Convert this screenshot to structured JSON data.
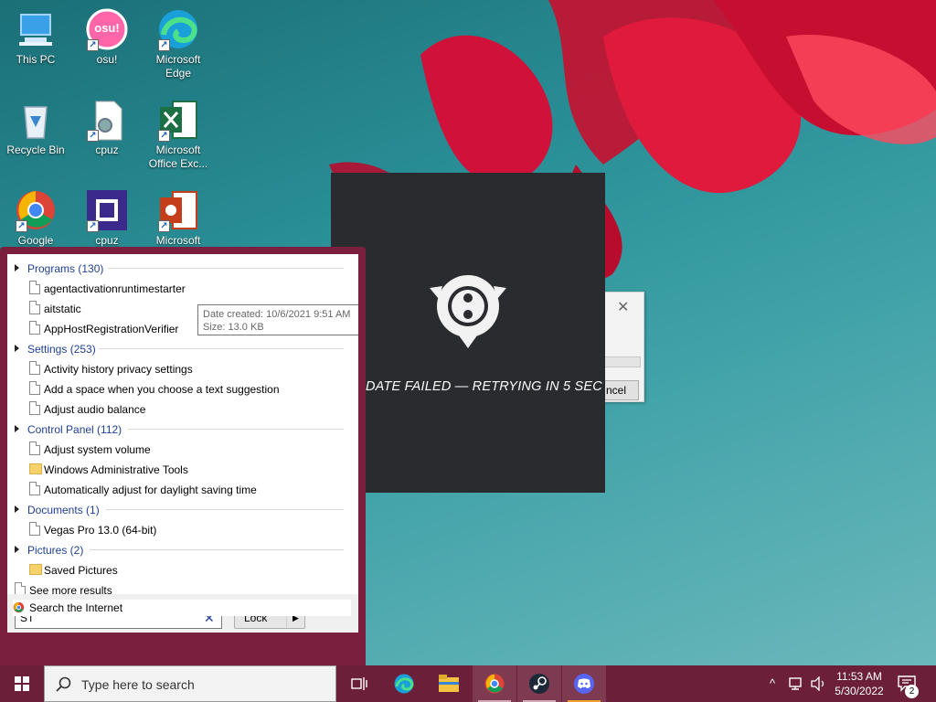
{
  "desktop": {
    "icons": [
      {
        "label": "This PC",
        "icon": "this-pc-icon"
      },
      {
        "label": "osu!",
        "icon": "osu-icon",
        "glyph": "osu!"
      },
      {
        "label": "Microsoft\nEdge",
        "icon": "edge-icon"
      },
      {
        "label": "Recycle Bin",
        "icon": "recycle-bin-icon"
      },
      {
        "label": "cpuz",
        "icon": "cpuz-file-icon"
      },
      {
        "label": "Microsoft\nOffice Exc...",
        "icon": "excel-icon"
      },
      {
        "label": "Google",
        "icon": "chrome-icon"
      },
      {
        "label": "cpuz",
        "icon": "cpuz-icon"
      },
      {
        "label": "Microsoft",
        "icon": "powerpoint-icon"
      }
    ]
  },
  "osu_window": {
    "status": "DATE FAILED — RETRYING IN 5 SEC"
  },
  "dialog": {
    "close": "✕",
    "cancel": "ncel"
  },
  "search_results": {
    "groups": [
      {
        "label": "Programs (130)",
        "items": [
          "agentactivationruntimestarter",
          "aitstatic",
          "AppHostRegistrationVerifier"
        ]
      },
      {
        "label": "Settings (253)",
        "items": [
          "Activity history privacy settings",
          "Add a space when you choose a text suggestion",
          "Adjust audio balance"
        ]
      },
      {
        "label": "Control Panel (112)",
        "items": [
          "Adjust system volume",
          "Windows Administrative Tools",
          "Automatically adjust for daylight saving time"
        ]
      },
      {
        "label": "Documents (1)",
        "items": [
          "Vegas Pro 13.0 (64-bit)"
        ]
      },
      {
        "label": "Pictures (2)",
        "items": [
          "Saved Pictures"
        ]
      }
    ],
    "see_more": "See more results",
    "search_internet": "Search the Internet",
    "tooltip": {
      "date_created": "Date created: 10/6/2021 9:51 AM",
      "size": "Size: 13.0 KB"
    }
  },
  "search_box": {
    "value": "ST",
    "clear": "✕",
    "lock_label": "Lock",
    "lock_arrow": "▶"
  },
  "taskbar": {
    "search_placeholder": "Type here to search",
    "apps": [
      "task-view-icon",
      "edge-icon",
      "file-explorer-icon",
      "chrome-icon",
      "steam-icon",
      "discord-icon"
    ],
    "time": "11:53 AM",
    "date": "5/30/2022",
    "tray_chevron": "^",
    "notification_count": "2"
  },
  "colors": {
    "accent": "#7b1f3f",
    "taskbar": "#6b1f38",
    "link": "#1e3f95"
  }
}
